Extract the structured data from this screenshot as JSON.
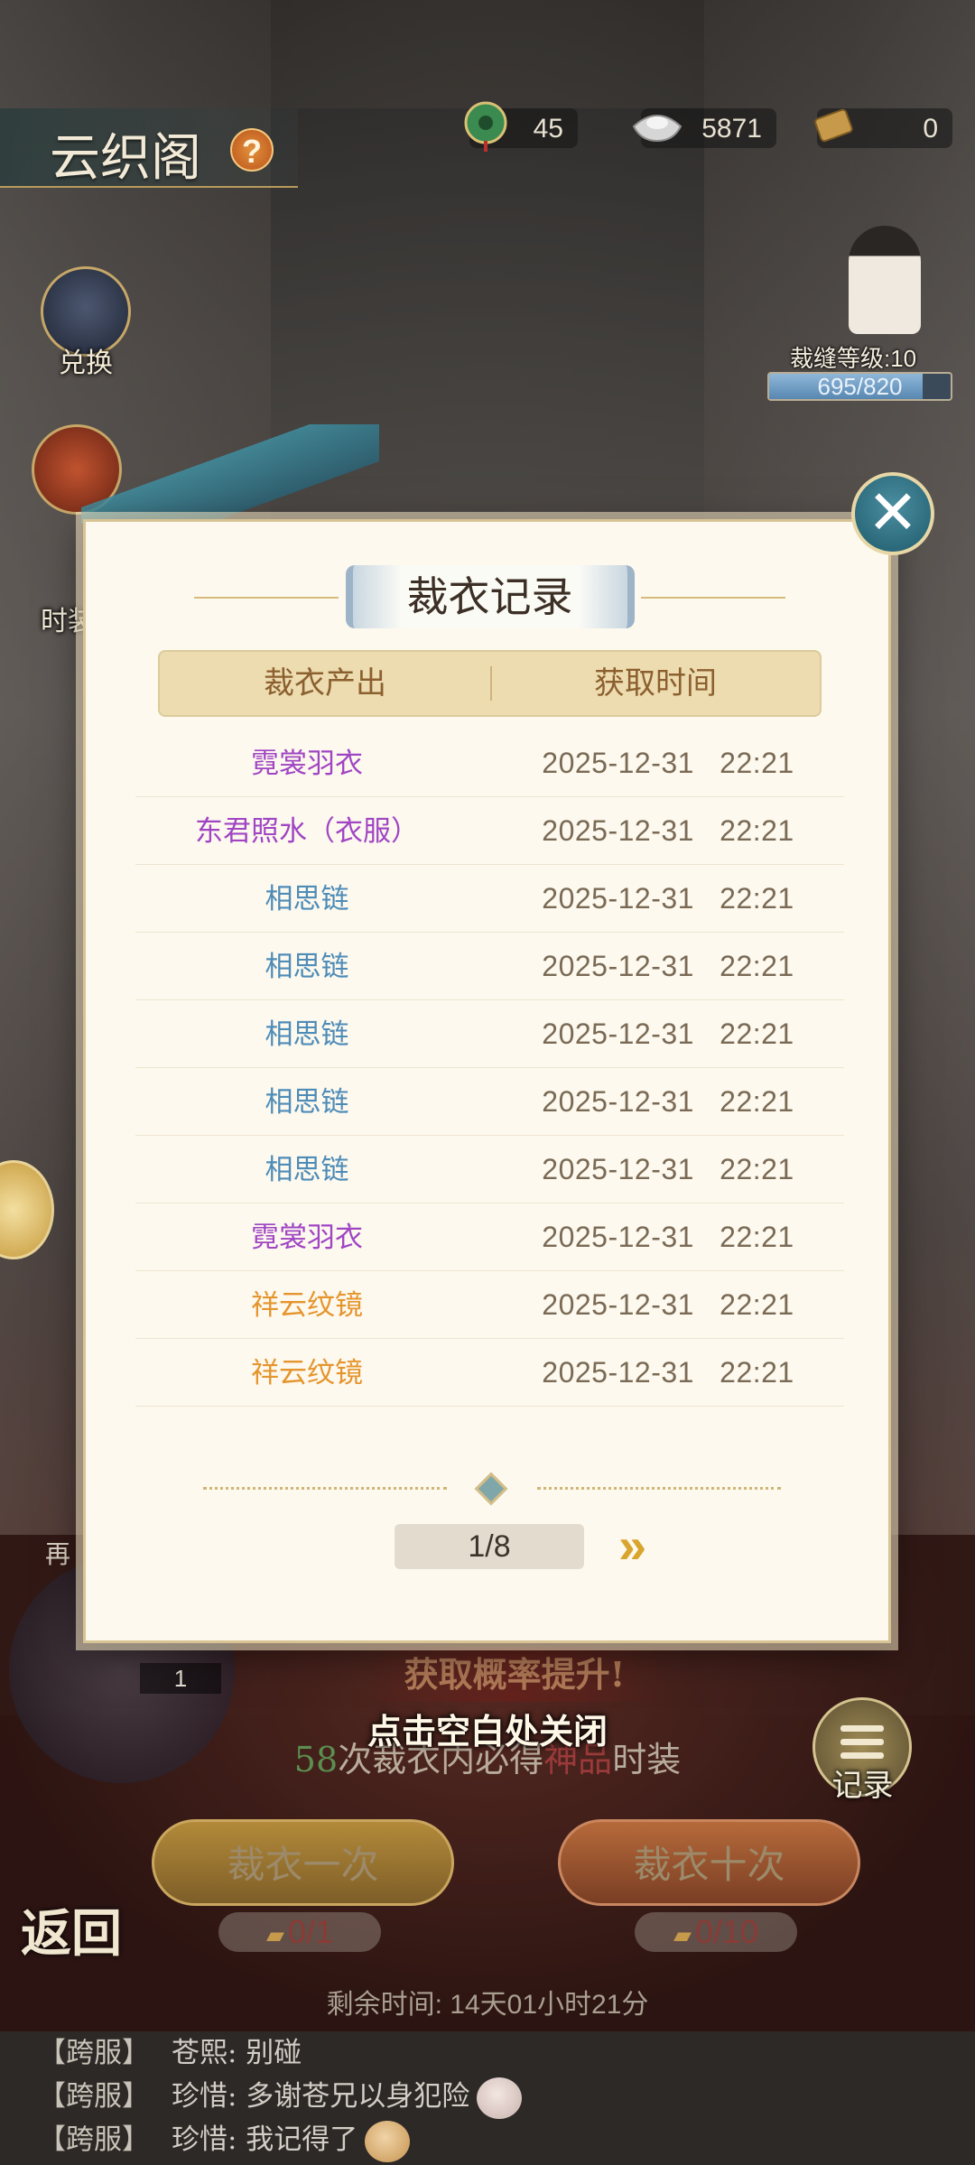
{
  "header": {
    "title": "云织阁",
    "help_label": "?",
    "currencies": [
      {
        "icon": "jade-coin-icon",
        "value": "45"
      },
      {
        "icon": "silver-ingot-icon",
        "value": "5871"
      },
      {
        "icon": "scroll-ticket-icon",
        "value": "0"
      }
    ]
  },
  "side_menu": {
    "exchange": "兑换",
    "fashion": "时装"
  },
  "npc": {
    "level_label": "裁缝等级:10",
    "exp_text": "695/820",
    "exp_progress": 0.8476
  },
  "modal": {
    "title": "裁衣记录",
    "close_label": "✕",
    "columns": [
      "裁衣产出",
      "获取时间"
    ],
    "rows": [
      {
        "item": "霓裳羽衣",
        "quality": "purple",
        "date": "2025-12-31",
        "time": "22:21"
      },
      {
        "item": "东君照水（衣服）",
        "quality": "purple",
        "date": "2025-12-31",
        "time": "22:21"
      },
      {
        "item": "相思链",
        "quality": "blue",
        "date": "2025-12-31",
        "time": "22:21"
      },
      {
        "item": "相思链",
        "quality": "blue",
        "date": "2025-12-31",
        "time": "22:21"
      },
      {
        "item": "相思链",
        "quality": "blue",
        "date": "2025-12-31",
        "time": "22:21"
      },
      {
        "item": "相思链",
        "quality": "blue",
        "date": "2025-12-31",
        "time": "22:21"
      },
      {
        "item": "相思链",
        "quality": "blue",
        "date": "2025-12-31",
        "time": "22:21"
      },
      {
        "item": "霓裳羽衣",
        "quality": "purple",
        "date": "2025-12-31",
        "time": "22:21"
      },
      {
        "item": "祥云纹镜",
        "quality": "orange",
        "date": "2025-12-31",
        "time": "22:21"
      },
      {
        "item": "祥云纹镜",
        "quality": "orange",
        "date": "2025-12-31",
        "time": "22:21"
      }
    ],
    "page": "1/8",
    "next_label": "»"
  },
  "bottom": {
    "tap_to_close": "点击空白处关闭",
    "probability_banner": "获取概率提升!",
    "guarantee_count": "58",
    "guarantee_prefix": "次裁衣内必得",
    "guarantee_rare": "神品",
    "guarantee_suffix": "时装",
    "record_label": "记录",
    "sew_once": "裁衣一次",
    "sew_ten": "裁衣十次",
    "cost_once": "0/1",
    "cost_ten": "0/10",
    "remaining": "剩余时间: 14天01小时21分",
    "back_label": "返回",
    "left_count": "1",
    "left_again": "再"
  },
  "chat": [
    {
      "channel": "【跨服】",
      "text": "苍熙: 别碰"
    },
    {
      "channel": "【跨服】",
      "text": "珍惜: 多谢苍兄以身犯险"
    },
    {
      "channel": "【跨服】",
      "text": "珍惜: 我记得了"
    }
  ],
  "colors": {
    "purple": "#a045c4",
    "blue": "#4e8cb8",
    "orange": "#e5952e",
    "gold": "#d9a52e"
  }
}
